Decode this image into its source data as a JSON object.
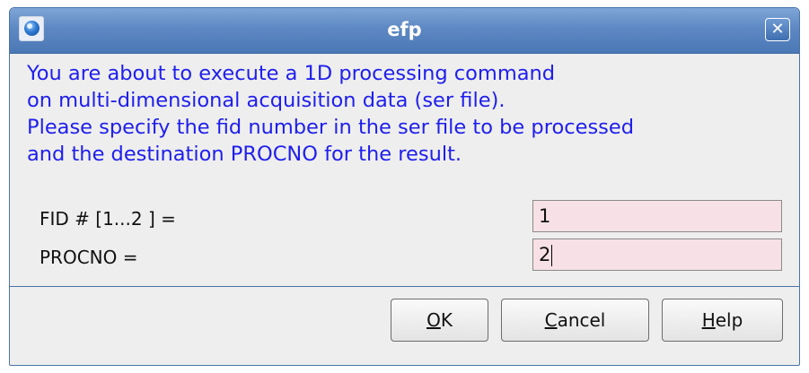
{
  "window": {
    "title": "efp",
    "close_glyph": "✕",
    "app_icon": "bruker-logo-icon"
  },
  "message": {
    "lines": [
      "You are about to execute a 1D processing command",
      "on multi-dimensional acquisition data (ser file).",
      "Please specify the fid number in the ser file to be processed",
      "and the destination PROCNO for the result."
    ],
    "color": "#1e1eef"
  },
  "form": {
    "fid_label": "FID # [1...2 ] =",
    "fid_value": "1",
    "procno_label": "PROCNO =",
    "procno_value": "2",
    "field_background": "#f8e1e6"
  },
  "buttons": {
    "ok": {
      "mnemonic": "O",
      "rest": "K"
    },
    "cancel": {
      "mnemonic": "C",
      "rest": "ancel"
    },
    "help": {
      "mnemonic": "H",
      "rest": "elp"
    }
  },
  "colors": {
    "titlebar": "#5d88c3",
    "window_background": "#eeeeee"
  }
}
